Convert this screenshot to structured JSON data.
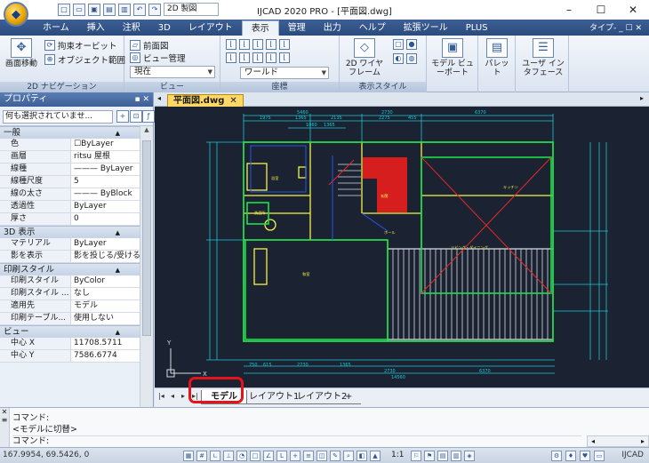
{
  "titlebar": {
    "title": "IJCAD 2020 PRO - [平面図.dwg]",
    "workspace": "2D 製図",
    "controls": {
      "minimize": "–",
      "maximize": "☐",
      "close": "✕"
    }
  },
  "ribbon_tabs": [
    "ホーム",
    "挿入",
    "注釈",
    "3D",
    "レイアウト",
    "表示",
    "管理",
    "出力",
    "ヘルプ",
    "拡張ツール",
    "PLUS"
  ],
  "ribbon_active_tab": "表示",
  "ribbon_right": "タイプ- _ ☐ ✕",
  "ribbon": {
    "nav": {
      "label": "2D ナビゲーション",
      "orbit": "拘束オービット",
      "pan": "画面移動",
      "range": "オブジェクト範囲"
    },
    "view": {
      "label": "ビュー",
      "front": "前面図",
      "manager": "ビュー管理",
      "current": "現在"
    },
    "coords": {
      "label": "座標",
      "world": "ワールド"
    },
    "visual": {
      "label": "表示スタイル",
      "style": "2D ワイヤフレーム"
    },
    "model": {
      "label": "モデル ビューポート"
    },
    "palette": {
      "label": "パレット"
    },
    "ui": {
      "label": "ユーザ インタフェース"
    }
  },
  "properties": {
    "title": "プロパティ",
    "selection": "何も選択されていませ...",
    "categories": [
      {
        "name": "一般",
        "rows": [
          {
            "key": "色",
            "value": "☐ByLayer"
          },
          {
            "key": "画層",
            "value": "ritsu 屋根"
          },
          {
            "key": "線種",
            "value": "——— ByLayer"
          },
          {
            "key": "線種尺度",
            "value": "5"
          },
          {
            "key": "線の太さ",
            "value": "——— ByBlock"
          },
          {
            "key": "透過性",
            "value": "ByLayer"
          },
          {
            "key": "厚さ",
            "value": "0"
          }
        ]
      },
      {
        "name": "3D 表示",
        "rows": [
          {
            "key": "マテリアル",
            "value": "ByLayer"
          },
          {
            "key": "影を表示",
            "value": "影を投じる/受ける"
          }
        ]
      },
      {
        "name": "印刷スタイル",
        "rows": [
          {
            "key": "印刷スタイル",
            "value": "ByColor"
          },
          {
            "key": "印刷スタイル ...",
            "value": "なし"
          },
          {
            "key": "適用先",
            "value": "モデル"
          },
          {
            "key": "印刷テーブル...",
            "value": "使用しない"
          }
        ]
      },
      {
        "name": "ビュー",
        "rows": [
          {
            "key": "中心 X",
            "value": "11708.5711"
          },
          {
            "key": "中心 Y",
            "value": "7586.6774"
          }
        ]
      }
    ]
  },
  "document_tab": "平面図.dwg",
  "drawing": {
    "dims_top": [
      "5460",
      "2730",
      "6370",
      "1975",
      "1365",
      "2135",
      "2275",
      "455",
      "1365",
      "1060",
      "1365"
    ],
    "dims_bottom": [
      "750",
      "615",
      "2730",
      "1365",
      "2730",
      "6370",
      "14560"
    ],
    "dims_right": [
      "2275",
      "1365",
      "3915"
    ],
    "rooms": [
      "ホール",
      "玄関",
      "リビング・ダイニング",
      "キッチン",
      "和室",
      "浴室",
      "洗面所"
    ]
  },
  "layout_tabs": [
    "モデル",
    "レイアウト1",
    "レイアウト2",
    "+"
  ],
  "active_layout_tab": "モデル",
  "command": {
    "history": [
      "コマンド:",
      "<モデルに切替>"
    ],
    "prompt": "コマンド:"
  },
  "status": {
    "coords": "167.9954, 69.5426, 0",
    "scale": "1:1",
    "brand": "IJCAD"
  },
  "colors": {
    "canvas": "#1b2231",
    "accent_red": "#e5131b",
    "wall": "#f5f54a",
    "room_outline": "#19e04c",
    "dimension": "#19c9d4",
    "fill_red": "#d61e1e"
  }
}
